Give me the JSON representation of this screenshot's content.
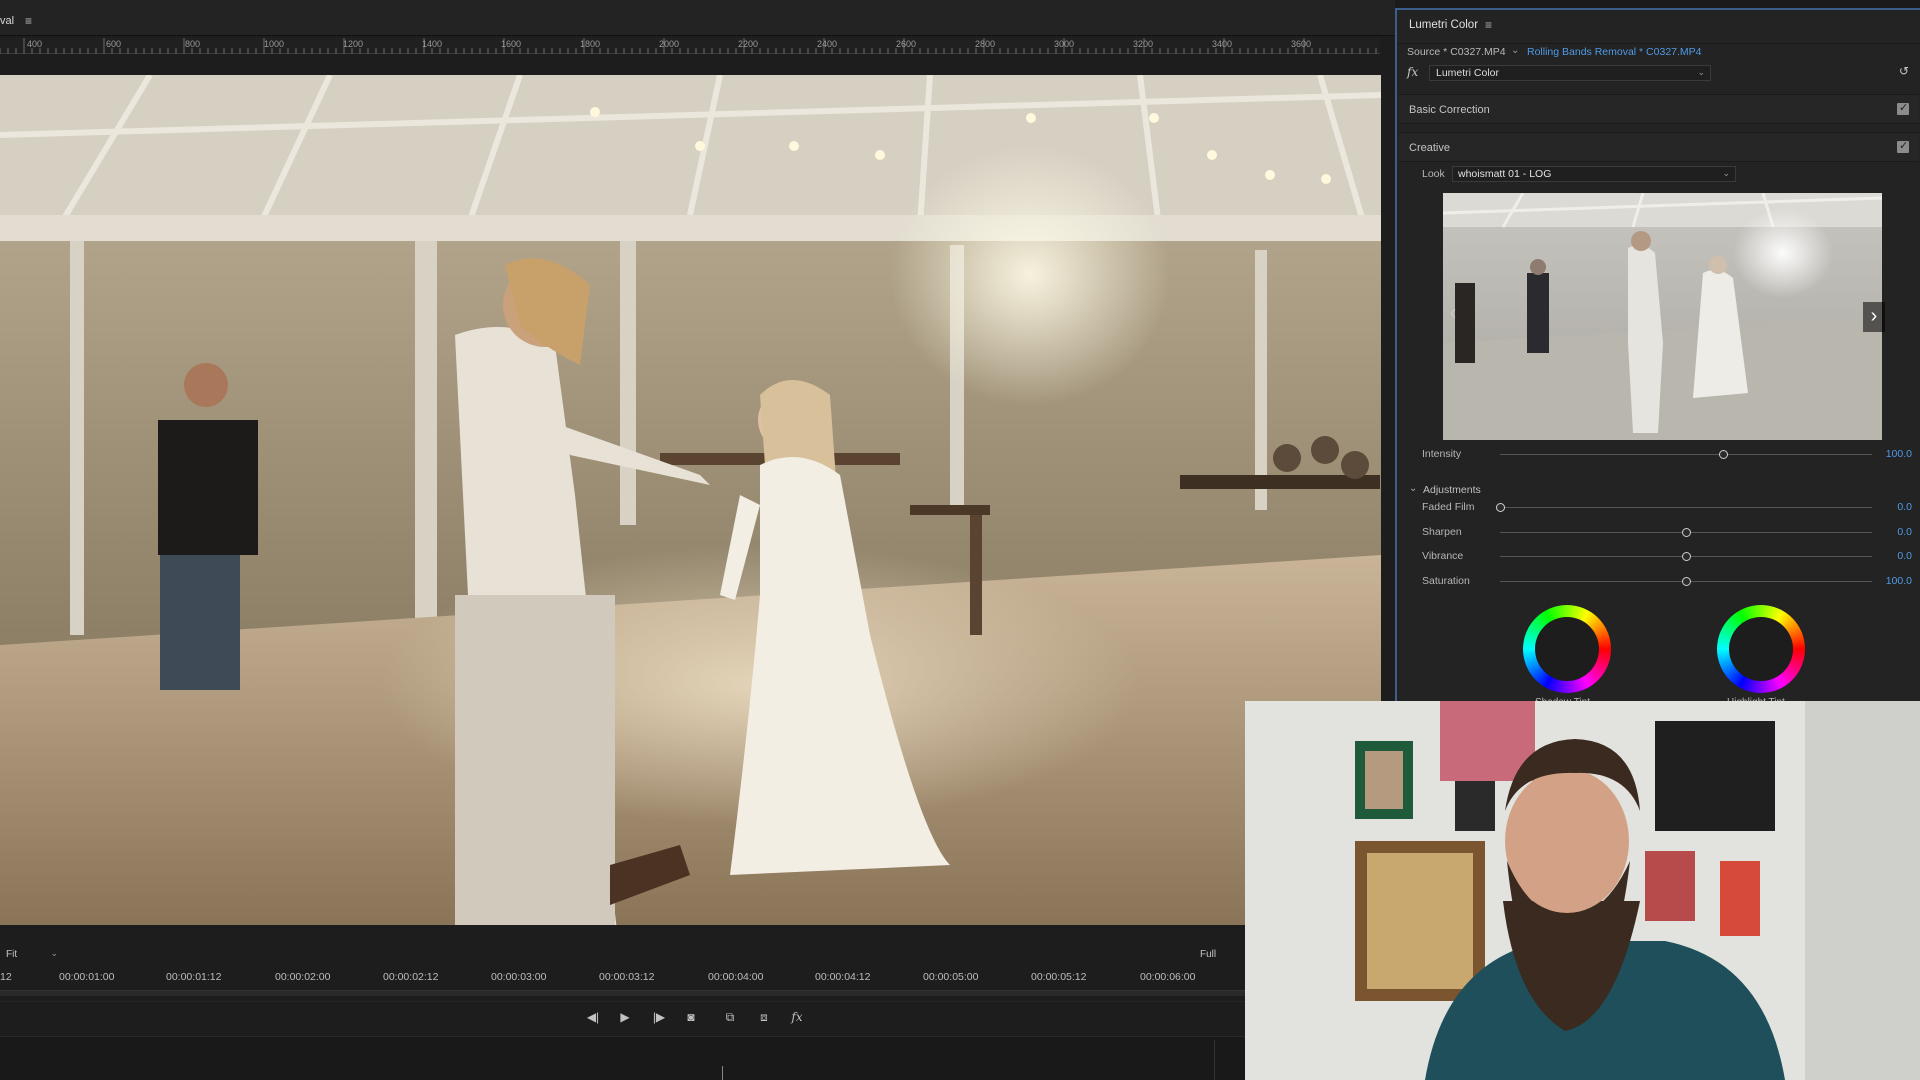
{
  "monitor": {
    "title_fragment": "val",
    "menu_icon": "hamburger-menu-icon",
    "ruler_labels": [
      "400",
      "600",
      "800",
      "1000",
      "1200",
      "1400",
      "1600",
      "1800",
      "2000",
      "2200",
      "2400",
      "2600",
      "2800",
      "3000",
      "3200",
      "3400",
      "3600"
    ],
    "fit_label": "Fit",
    "full_label": "Full",
    "timecodes": [
      "12",
      "00:00:01:00",
      "00:00:01:12",
      "00:00:02:00",
      "00:00:02:12",
      "00:00:03:00",
      "00:00:03:12",
      "00:00:04:00",
      "00:00:04:12",
      "00:00:05:00",
      "00:00:05:12",
      "00:00:06:00"
    ],
    "transport_icons": [
      "step-back-icon",
      "play-icon",
      "step-forward-icon",
      "export-frame-icon",
      "overlay-toggle-icon",
      "compare-view-icon",
      "fx-icon"
    ]
  },
  "lumetri": {
    "title": "Lumetri Color",
    "menu_icon": "hamburger-menu-icon",
    "source_label": "Source * C0327.MP4",
    "sequence_label": "Rolling Bands Removal * C0327.MP4",
    "fx_symbol": "fx",
    "effect_name": "Lumetri Color",
    "sections": {
      "basic_correction": "Basic Correction",
      "creative": "Creative"
    },
    "look": {
      "label": "Look",
      "value": "whoismatt 01 - LOG"
    },
    "intensity": {
      "label": "Intensity",
      "value_text": "100.0",
      "fraction": 0.6
    },
    "adjustments_label": "Adjustments",
    "sliders": [
      {
        "label": "Faded Film",
        "value_text": "0.0",
        "fraction": 0.0
      },
      {
        "label": "Sharpen",
        "value_text": "0.0",
        "fraction": 0.5
      },
      {
        "label": "Vibrance",
        "value_text": "0.0",
        "fraction": 0.5
      },
      {
        "label": "Saturation",
        "value_text": "100.0",
        "fraction": 0.5
      }
    ],
    "wheels": {
      "shadow_tint": "Shadow Tint",
      "highlight_tint": "Highlight Tint"
    }
  },
  "colors": {
    "accent_blue": "#4f9ae6",
    "panel_bg": "#232323",
    "focus_border": "#3a5f8c"
  }
}
